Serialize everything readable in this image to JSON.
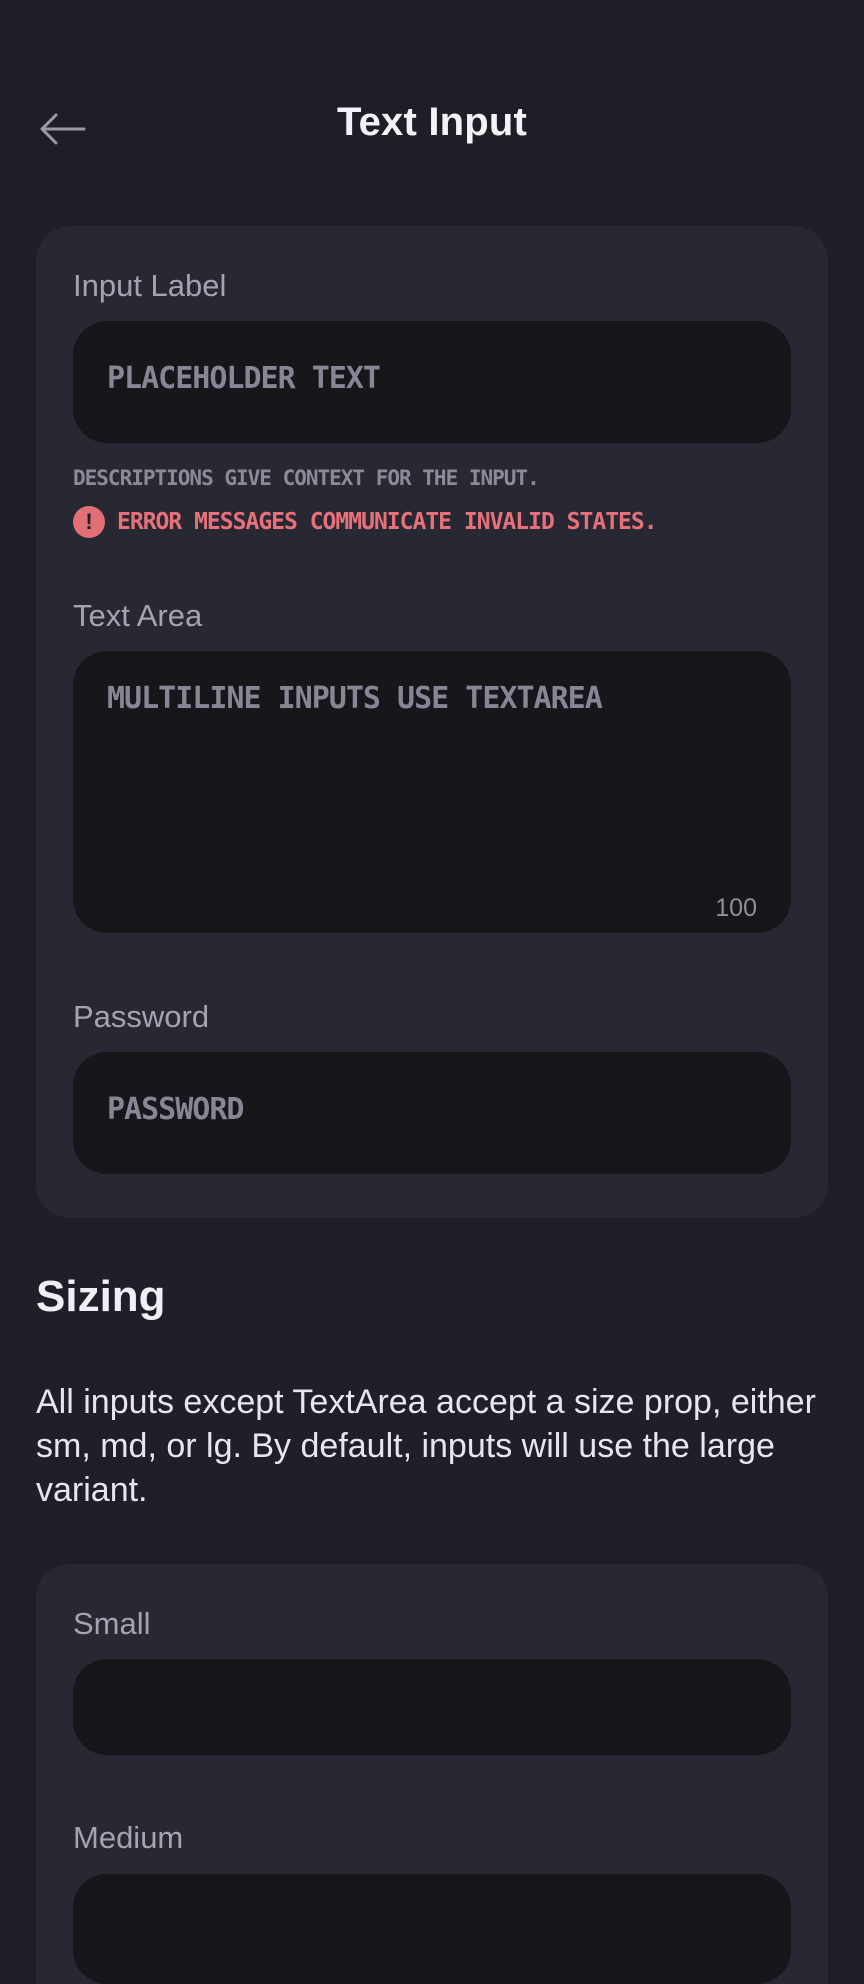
{
  "header": {
    "title": "Text Input",
    "back_icon": "arrow-left-icon"
  },
  "examples": {
    "input": {
      "label": "Input Label",
      "placeholder": "Placeholder text",
      "description": "Descriptions give context for the input.",
      "error": "Error messages communicate invalid states.",
      "error_icon": "alert-circle-icon"
    },
    "textarea": {
      "label": "Text Area",
      "placeholder": "Multiline inputs use TextArea",
      "counter": "100"
    },
    "password": {
      "label": "Password",
      "placeholder": "Password"
    }
  },
  "sizing": {
    "heading": "Sizing",
    "body": "All inputs except TextArea accept a size prop, either sm, md, or lg. By default, inputs will use the large variant.",
    "small_label": "Small",
    "medium_label": "Medium"
  },
  "colors": {
    "background": "#1f1f29",
    "card": "#282833",
    "input": "#16161b",
    "error": "#e7717a"
  }
}
